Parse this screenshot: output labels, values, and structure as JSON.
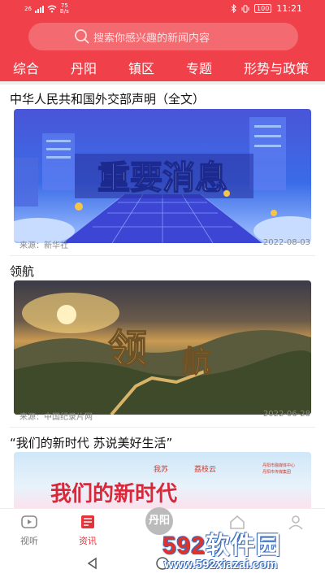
{
  "status_bar": {
    "network": "26",
    "speed_value": "75",
    "speed_unit": "B/s",
    "battery": "100",
    "time": "11:21"
  },
  "search": {
    "placeholder": "搜索你感兴趣的新闻内容"
  },
  "tabs": [
    {
      "label": "综合",
      "active": true
    },
    {
      "label": "丹阳"
    },
    {
      "label": "镇区"
    },
    {
      "label": "专题"
    },
    {
      "label": "形势与政策"
    }
  ],
  "articles": [
    {
      "title": "中华人民共和国外交部声明（全文）",
      "image_text": "重要消息",
      "source": "来源：新华社",
      "date": "2022-08-03"
    },
    {
      "title": "领航",
      "image_text": "领航",
      "source": "来源：中国纪录片网",
      "date": "2022-06-28"
    },
    {
      "title": "“我们的新时代 苏说美好生活”",
      "image_text": "我们的新时代",
      "image_logos": [
        "我苏",
        "荔枝云",
        "丹阳市融媒体中心",
        "丹阳市传媒集团"
      ]
    }
  ],
  "bottom_nav": [
    {
      "label": "视听",
      "icon": "video-icon"
    },
    {
      "label": "资讯",
      "icon": "news-icon",
      "active": true
    },
    {
      "label": "",
      "icon": "home-icon"
    },
    {
      "label": "",
      "icon": "service-icon"
    },
    {
      "label": "",
      "icon": "profile-icon"
    }
  ],
  "watermark": {
    "brand_num": "592",
    "brand_text": "软件园",
    "url": "www.592xiazai.com",
    "badge": "丹阳"
  },
  "colors": {
    "accent": "#f0404a",
    "active_nav": "#e8323a"
  }
}
